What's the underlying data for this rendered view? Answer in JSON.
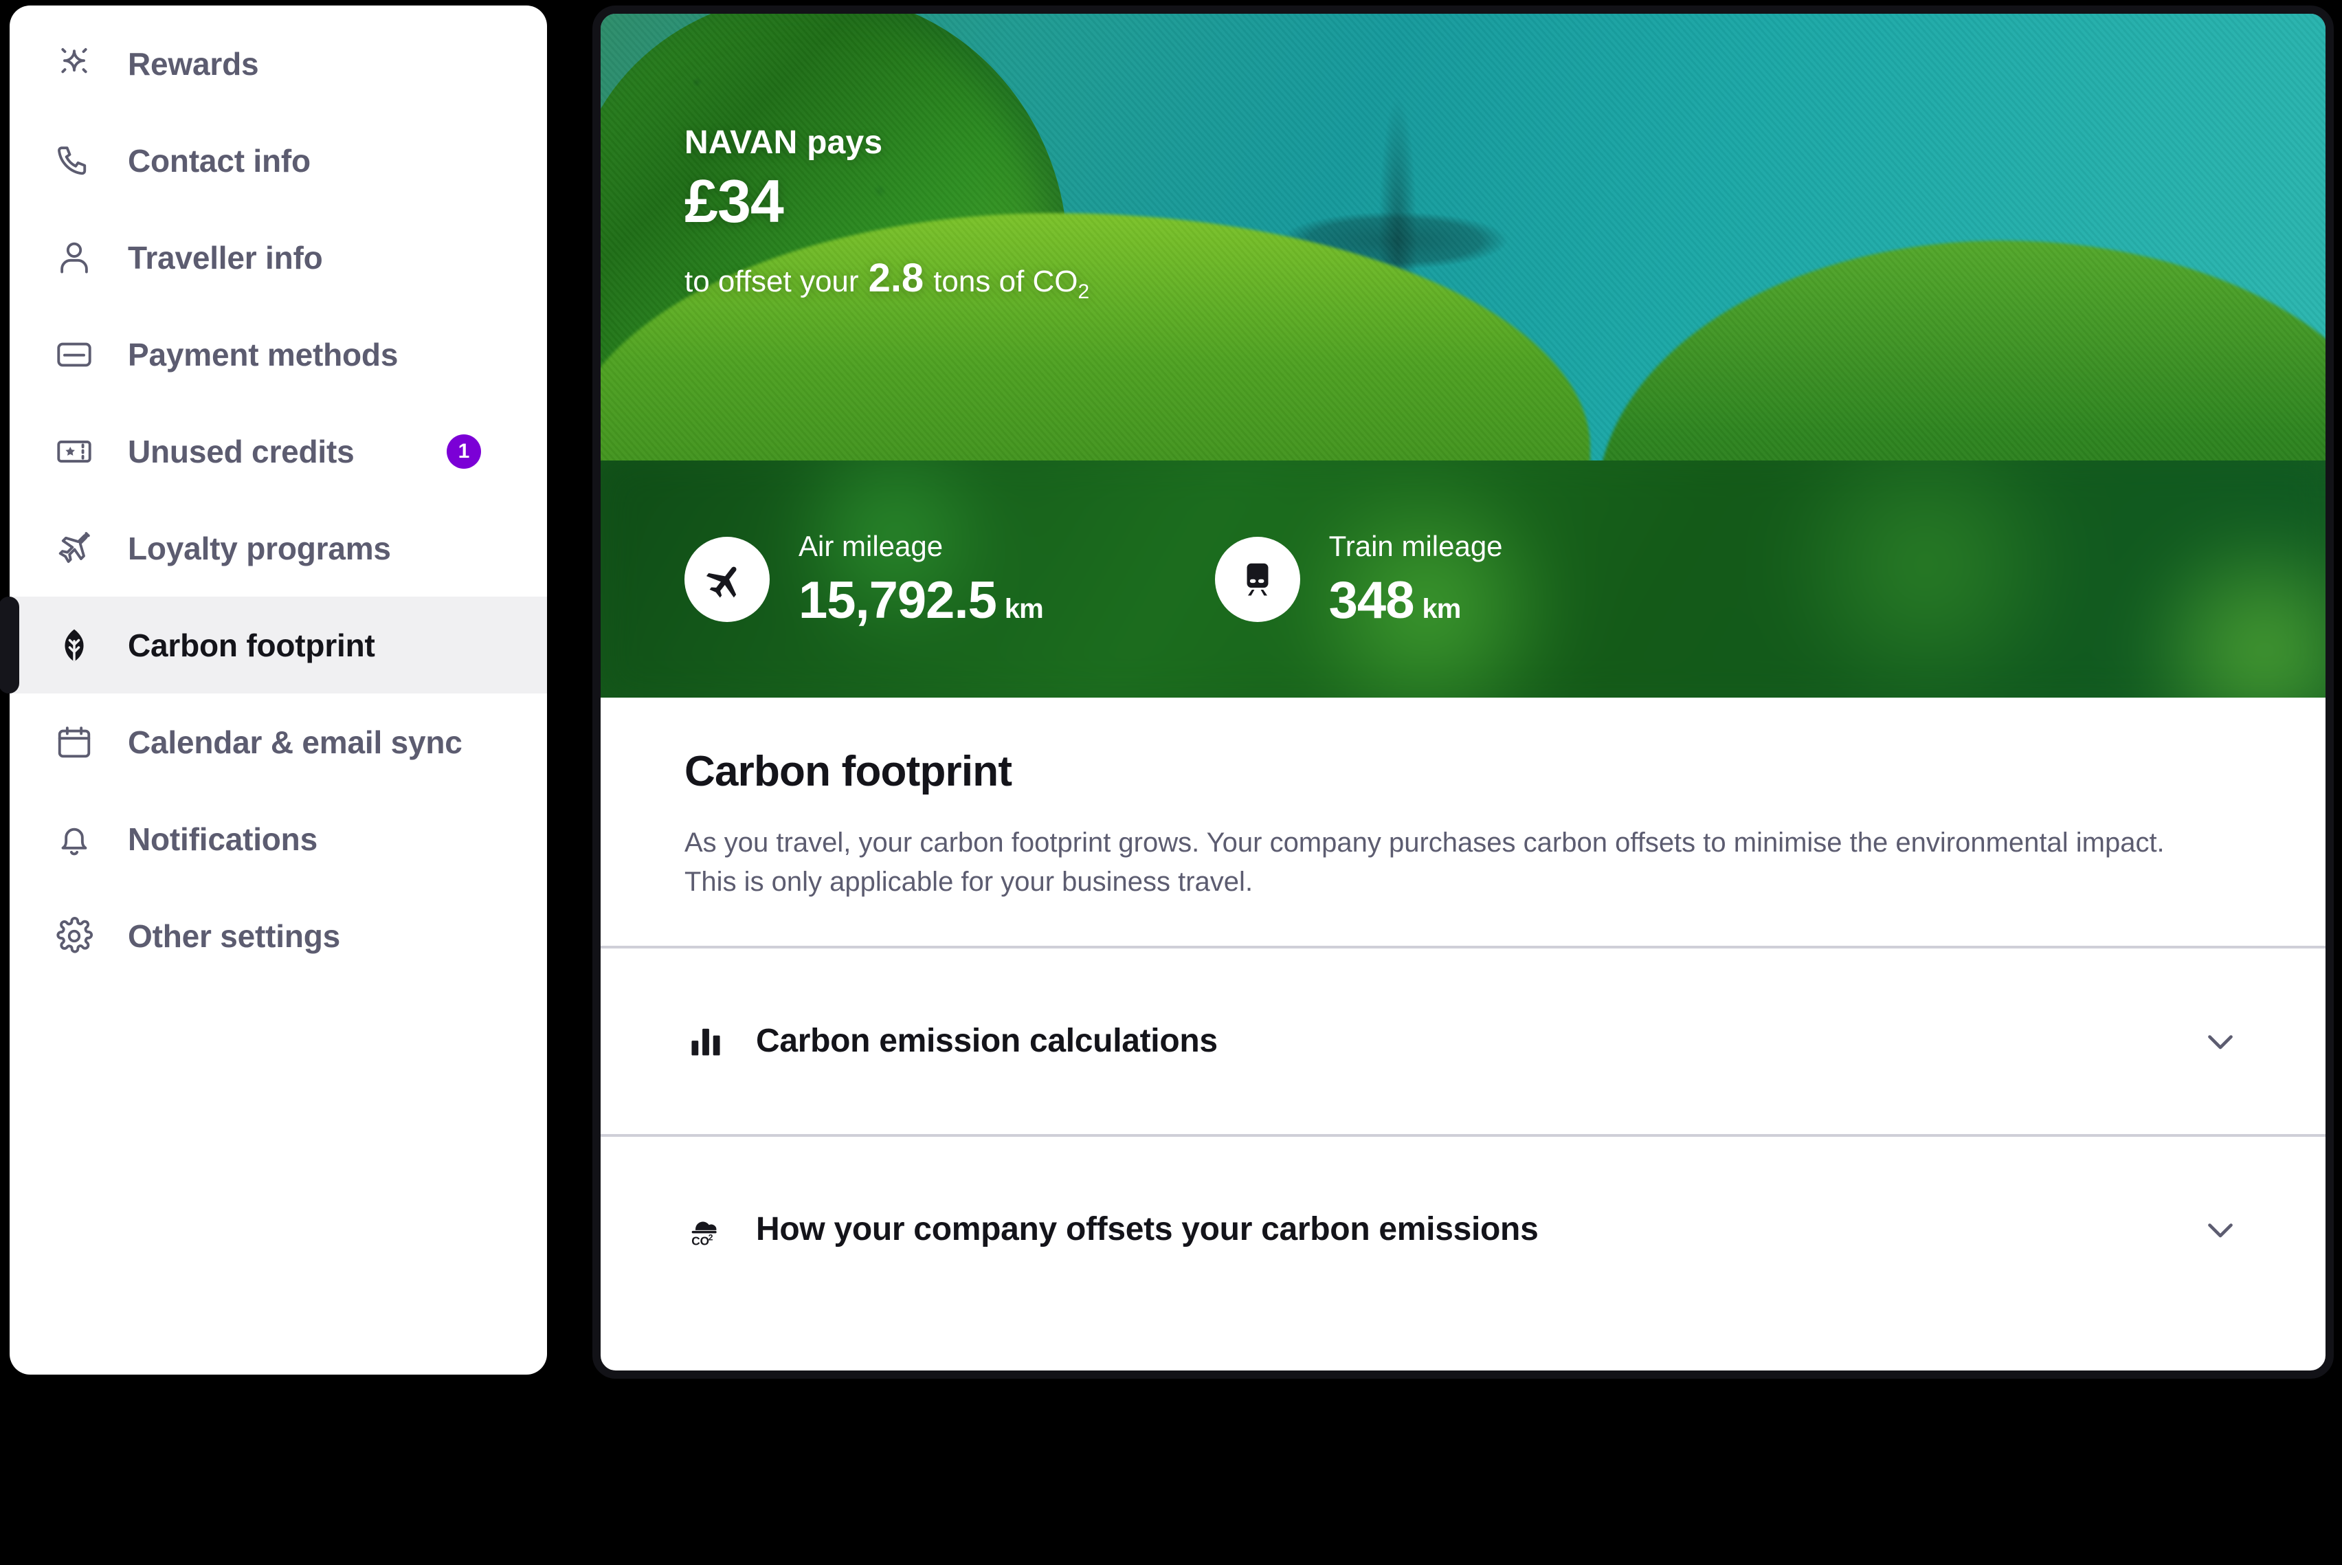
{
  "sidebar": {
    "items": [
      {
        "label": "Rewards",
        "icon": "sparkle-icon",
        "active": false,
        "badge": null
      },
      {
        "label": "Contact info",
        "icon": "phone-icon",
        "active": false,
        "badge": null
      },
      {
        "label": "Traveller info",
        "icon": "person-icon",
        "active": false,
        "badge": null
      },
      {
        "label": "Payment methods",
        "icon": "credit-card-icon",
        "active": false,
        "badge": null
      },
      {
        "label": "Unused credits",
        "icon": "ticket-icon",
        "active": false,
        "badge": "1"
      },
      {
        "label": "Loyalty programs",
        "icon": "airplane-icon",
        "active": false,
        "badge": null
      },
      {
        "label": "Carbon footprint",
        "icon": "leaf-icon",
        "active": true,
        "badge": null
      },
      {
        "label": "Calendar & email sync",
        "icon": "calendar-icon",
        "active": false,
        "badge": null
      },
      {
        "label": "Notifications",
        "icon": "bell-icon",
        "active": false,
        "badge": null
      },
      {
        "label": "Other settings",
        "icon": "gear-icon",
        "active": false,
        "badge": null
      }
    ],
    "badge_color": "#7b00d6",
    "active_color": "#f0f0f2"
  },
  "hero": {
    "payer": "NAVAN pays",
    "amount": "£34",
    "offset_prefix": "to offset your",
    "offset_value": "2.8",
    "offset_suffix": "tons of CO",
    "offset_subscript": "2"
  },
  "stats": [
    {
      "label": "Air mileage",
      "value": "15,792.5",
      "unit": "km",
      "icon": "airplane-icon"
    },
    {
      "label": "Train mileage",
      "value": "348",
      "unit": "km",
      "icon": "train-icon"
    }
  ],
  "main": {
    "title": "Carbon footprint",
    "description": "As you travel, your carbon footprint grows. Your company purchases carbon offsets to minimise the environmental impact. This is only applicable for your business travel.",
    "accordions": [
      {
        "label": "Carbon emission calculations",
        "icon": "bar-chart-icon",
        "chevron": "chevron-down-icon"
      },
      {
        "label": "How your company offsets your carbon emissions",
        "icon": "co2-cloud-icon",
        "chevron": "chevron-down-icon"
      }
    ]
  }
}
